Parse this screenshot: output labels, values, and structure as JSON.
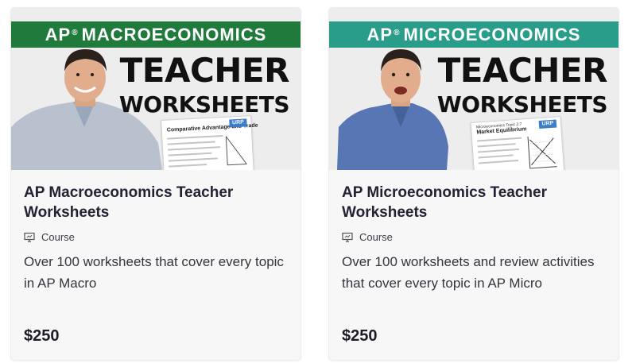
{
  "cards": [
    {
      "banner_prefix": "AP",
      "banner_mark": "®",
      "banner_subject": "MACROECONOMICS",
      "banner_color": "#1f7a3c",
      "thumb_line1": "TEACHER",
      "thumb_line2": "WORKSHEETS",
      "sheet_heading": "Comparative Advantage and Trade",
      "sheet_logo": "URP",
      "title": "AP Macroeconomics Teacher Worksheets",
      "type_label": "Course",
      "description": "Over 100 worksheets that cover every topic in AP Macro",
      "price": "$250"
    },
    {
      "banner_prefix": "AP",
      "banner_mark": "®",
      "banner_subject": "MICROECONOMICS",
      "banner_color": "#2a9d8a",
      "thumb_line1": "TEACHER",
      "thumb_line2": "WORKSHEETS",
      "sheet_topic": "Microeconomics Topic 2.7",
      "sheet_heading": "Market Equilibrium",
      "sheet_logo": "URP",
      "title": "AP Microeconomics Teacher Worksheets",
      "type_label": "Course",
      "description": "Over 100 worksheets and review activities that cover every topic in AP Micro",
      "price": "$250"
    }
  ],
  "icons": {
    "course": "presentation-board-icon"
  }
}
